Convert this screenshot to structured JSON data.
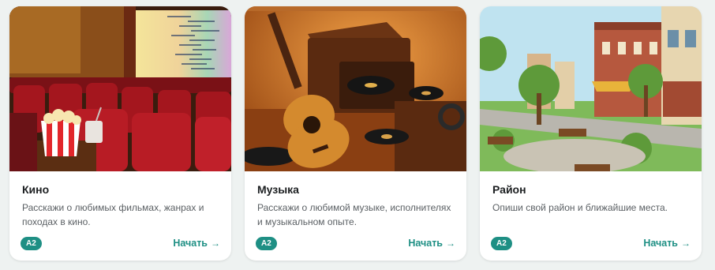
{
  "cards": [
    {
      "title": "Кино",
      "description": "Расскажи о любимых фильмах, жанрах и походах в кино.",
      "level": "A2",
      "action": "Начать",
      "image": "cinema-illustration"
    },
    {
      "title": "Музыка",
      "description": "Расскажи о любимой музыке, исполнителях и музыкальном опыте.",
      "level": "A2",
      "action": "Начать",
      "image": "music-illustration"
    },
    {
      "title": "Район",
      "description": "Опиши свой район и ближайшие места.",
      "level": "A2",
      "action": "Начать",
      "image": "neighborhood-illustration"
    }
  ],
  "icons": {
    "action_arrow": "→"
  },
  "colors": {
    "accent": "#1e8f84",
    "title": "#1c1f21",
    "text": "#5b6064",
    "background": "#eef2f1"
  }
}
